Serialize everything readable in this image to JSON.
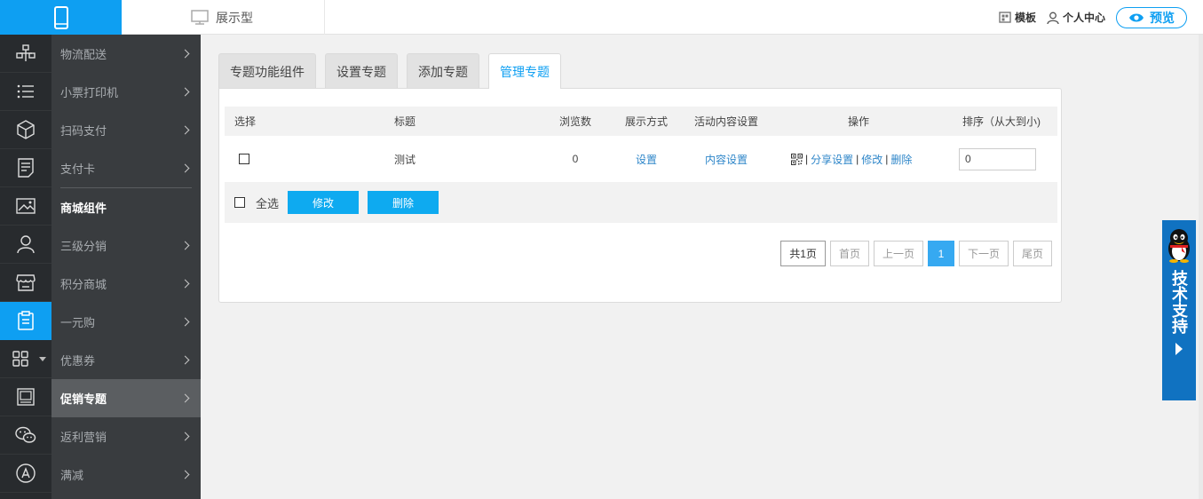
{
  "topbar": {
    "view_label": "展示型",
    "template_label": "模板",
    "user_center_label": "个人中心",
    "preview_label": "预览"
  },
  "rail": {
    "icons": [
      "hierarchy-icon",
      "list-icon",
      "box-icon",
      "document-icon",
      "image-icon",
      "user-icon",
      "store-icon",
      "clipboard-icon",
      "grid-icon",
      "photo-frame-icon",
      "wechat-icon",
      "appstore-icon"
    ],
    "active_index": 7
  },
  "submenu": {
    "items": [
      {
        "label": "物流配送"
      },
      {
        "label": "小票打印机"
      },
      {
        "label": "扫码支付"
      },
      {
        "label": "支付卡"
      }
    ],
    "section_header": "商城组件",
    "section_items": [
      {
        "label": "三级分销"
      },
      {
        "label": "积分商城"
      },
      {
        "label": "一元购"
      },
      {
        "label": "优惠券"
      },
      {
        "label": "促销专题"
      },
      {
        "label": "返利营销"
      },
      {
        "label": "满减"
      }
    ],
    "active_label": "促销专题"
  },
  "tabs": [
    {
      "label": "专题功能组件"
    },
    {
      "label": "设置专题"
    },
    {
      "label": "添加专题"
    },
    {
      "label": "管理专题"
    }
  ],
  "table": {
    "headers": {
      "select": "选择",
      "title": "标题",
      "views": "浏览数",
      "display": "展示方式",
      "content": "活动内容设置",
      "ops": "操作",
      "sort": "排序（从大到小)"
    },
    "rows": [
      {
        "title": "测试",
        "views": "0",
        "display_link": "设置",
        "content_link": "内容设置",
        "share_link": "分享设置",
        "edit_link": "修改",
        "delete_link": "删除",
        "sort_value": "0"
      }
    ]
  },
  "footer": {
    "select_all_label": "全选",
    "edit_button": "修改",
    "delete_button": "删除"
  },
  "pager": {
    "total": "共1页",
    "first": "首页",
    "prev": "上一页",
    "current": "1",
    "next": "下一页",
    "last": "尾页"
  },
  "support": {
    "label": "技术支持"
  },
  "colors": {
    "accent": "#0e9ff2",
    "rail_bg": "#282b2e",
    "submenu_bg": "#393c3f",
    "support_bg": "#1072c1"
  }
}
